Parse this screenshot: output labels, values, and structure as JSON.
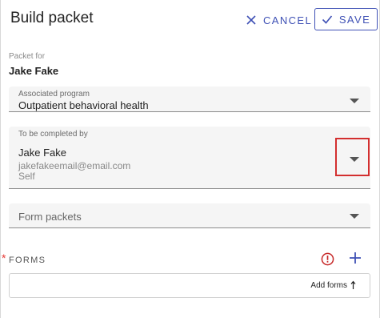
{
  "header": {
    "title": "Build packet",
    "cancel_label": "CANCEL",
    "save_label": "SAVE"
  },
  "packet_for": {
    "label": "Packet for",
    "value": "Jake Fake"
  },
  "associated_program": {
    "label": "Associated program",
    "value": "Outpatient behavioral health"
  },
  "completed_by": {
    "label": "To be completed by",
    "name": "Jake Fake",
    "email": "jakefakeemail@email.com",
    "relation": "Self"
  },
  "form_packets": {
    "placeholder": "Form packets"
  },
  "forms": {
    "required_mark": "*",
    "label": "FORMS",
    "add_forms_label": "Add forms"
  },
  "colors": {
    "accent": "#3f51b5",
    "highlight": "#d32f2f",
    "required": "#e53935"
  }
}
